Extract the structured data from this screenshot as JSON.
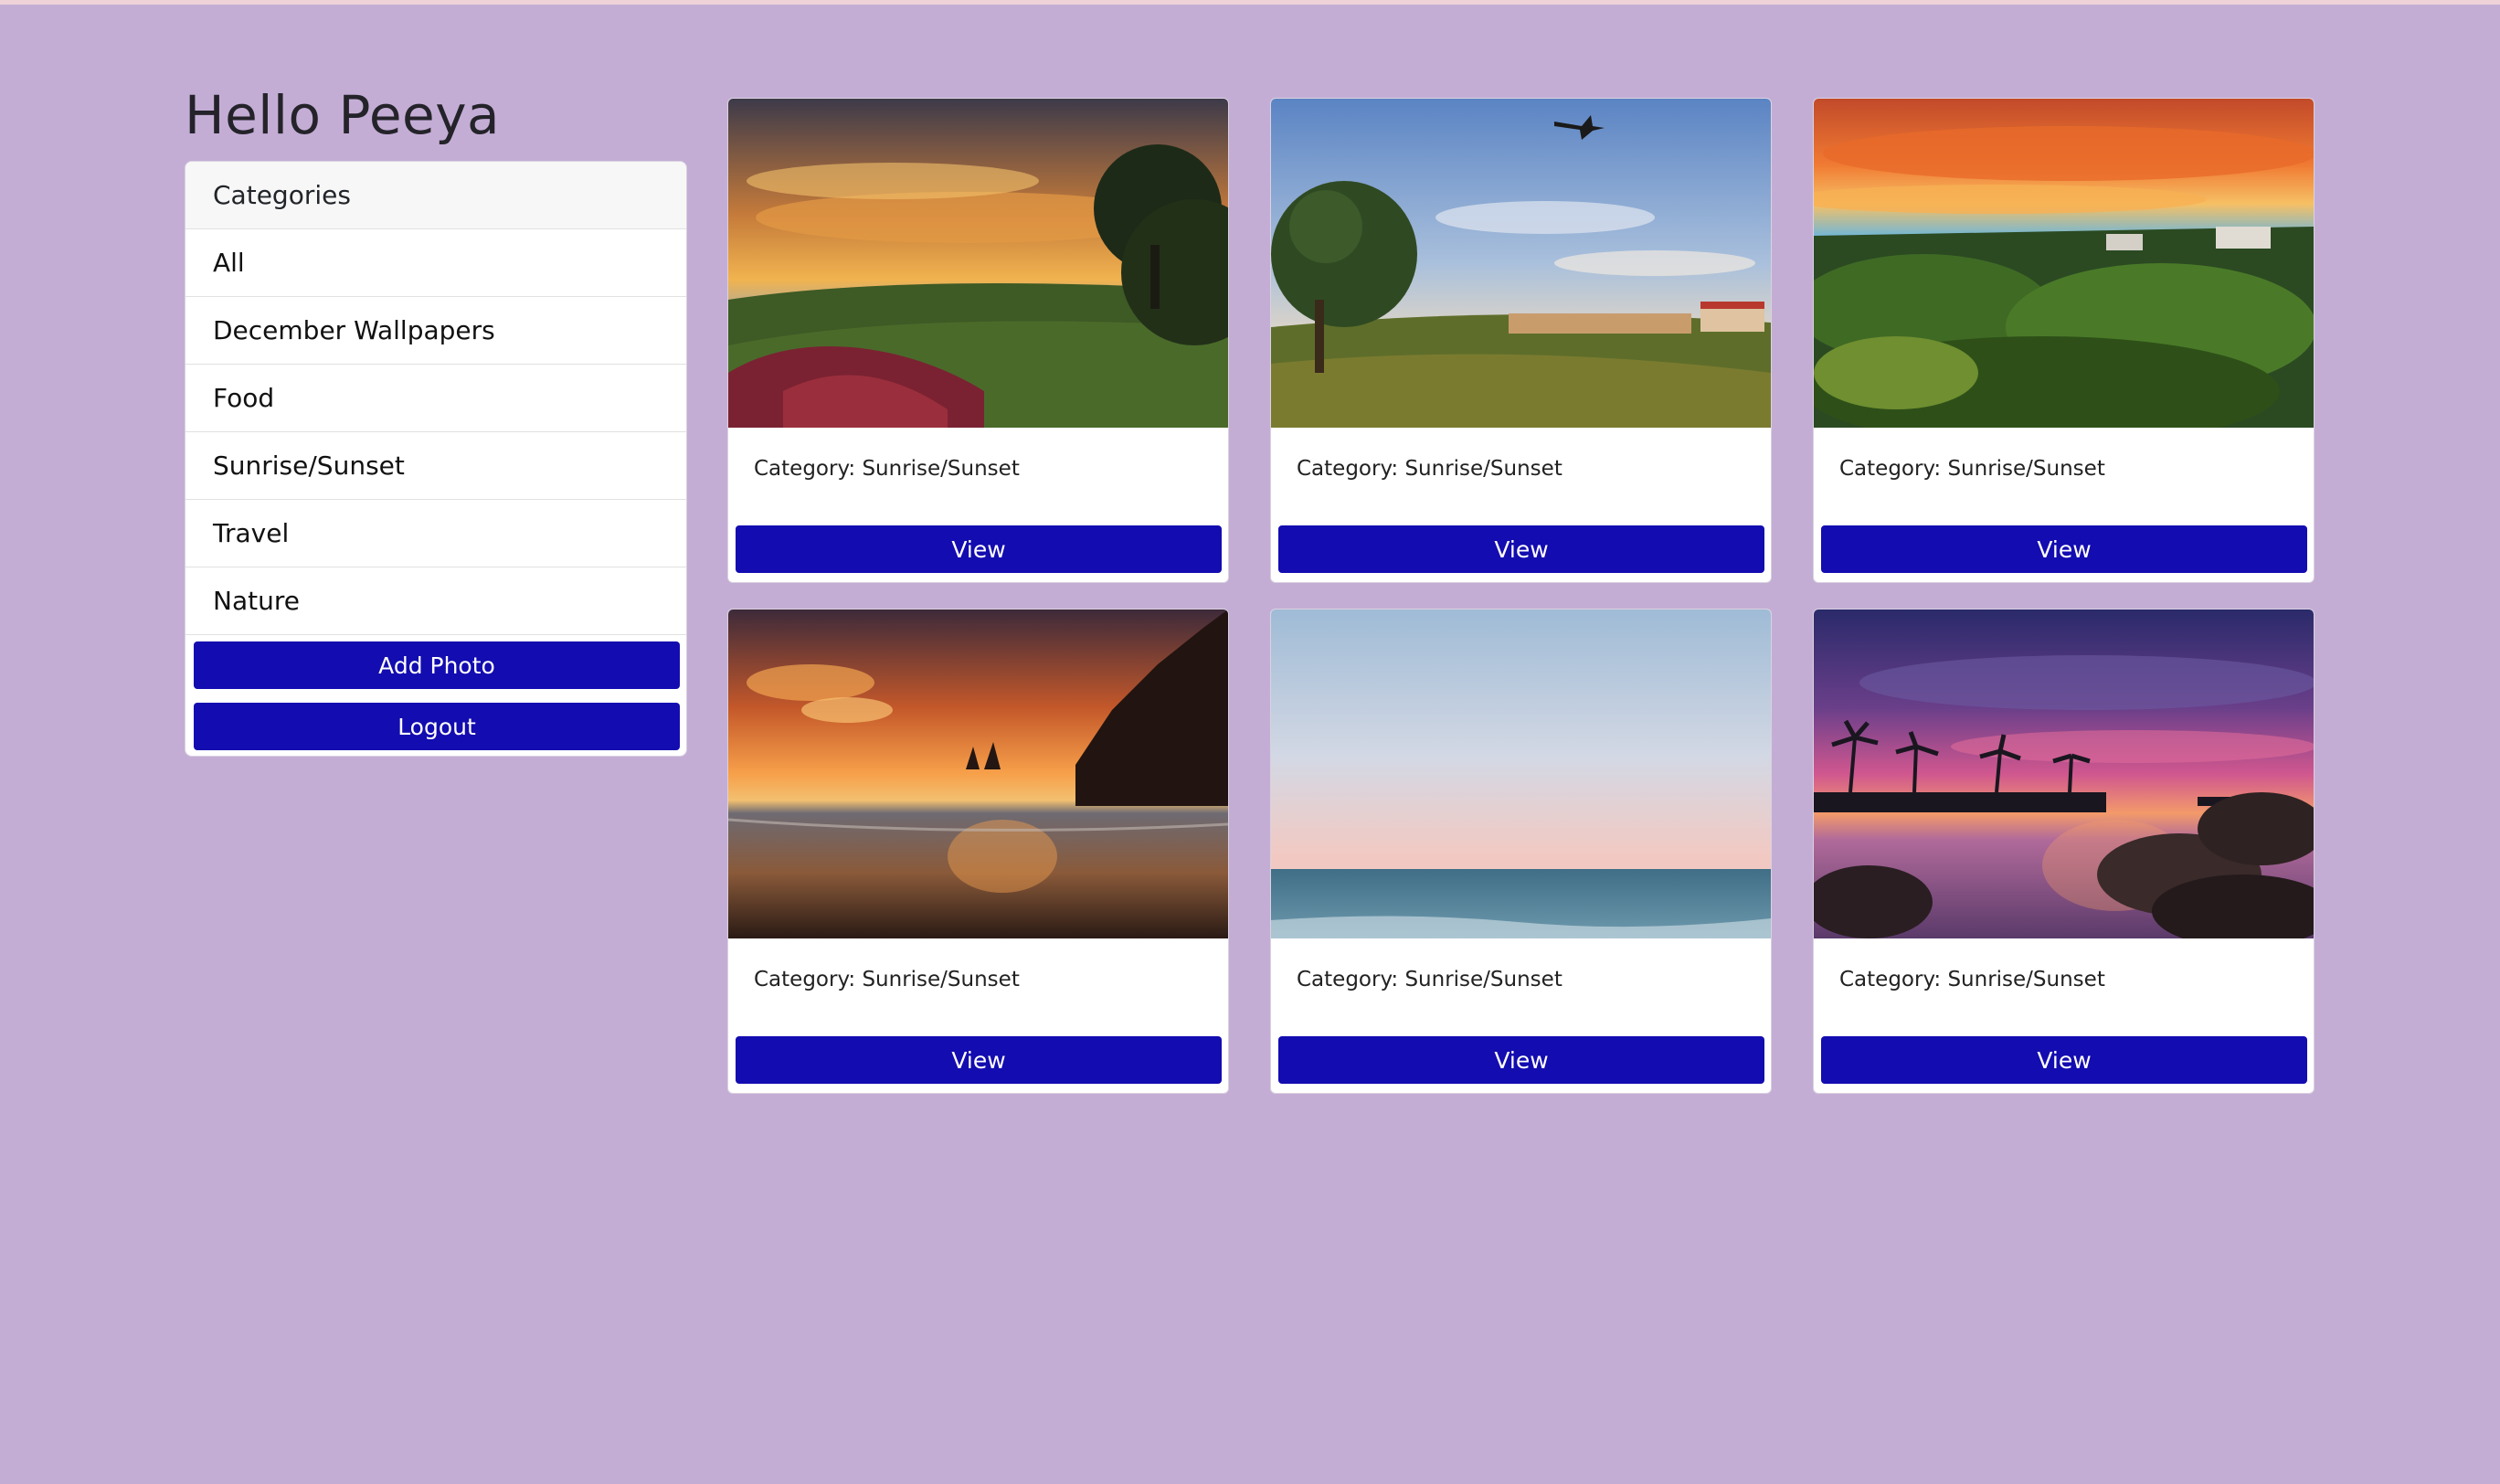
{
  "greeting": "Hello Peeya",
  "sidebar": {
    "header": "Categories",
    "items": [
      {
        "label": "All"
      },
      {
        "label": "December Wallpapers"
      },
      {
        "label": "Food"
      },
      {
        "label": "Sunrise/Sunset"
      },
      {
        "label": "Travel"
      },
      {
        "label": "Nature"
      }
    ],
    "add_photo_label": "Add Photo",
    "logout_label": "Logout"
  },
  "cards": [
    {
      "category": "Category: Sunrise/Sunset",
      "view_label": "View"
    },
    {
      "category": "Category: Sunrise/Sunset",
      "view_label": "View"
    },
    {
      "category": "Category: Sunrise/Sunset",
      "view_label": "View"
    },
    {
      "category": "Category: Sunrise/Sunset",
      "view_label": "View"
    },
    {
      "category": "Category: Sunrise/Sunset",
      "view_label": "View"
    },
    {
      "category": "Category: Sunrise/Sunset",
      "view_label": "View"
    }
  ],
  "colors": {
    "page_background": "#c4add5",
    "button_primary": "#130cb0",
    "card_background": "#ffffff"
  }
}
